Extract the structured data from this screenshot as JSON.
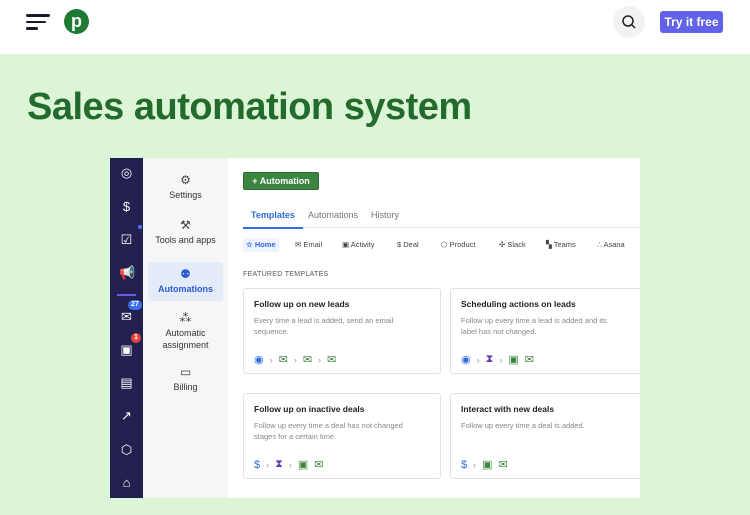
{
  "header": {
    "try_label": "Try it free",
    "logo_letter": "p"
  },
  "title": "Sales automation system",
  "rail": {
    "mail_badge": "27",
    "calendar_badge": "1"
  },
  "subnav": [
    {
      "label": "Settings",
      "icon": "gear-icon"
    },
    {
      "label": "Tools and apps",
      "icon": "tools-icon"
    },
    {
      "label": "Automations",
      "icon": "automation-icon"
    },
    {
      "label": "Automatic assignment",
      "icon": "assignment-icon"
    },
    {
      "label": "Billing",
      "icon": "card-icon"
    }
  ],
  "main": {
    "add_label": "+  Automation",
    "tabs": [
      "Templates",
      "Automations",
      "History"
    ],
    "categories": [
      "Home",
      "Email",
      "Activity",
      "Deal",
      "Product",
      "Slack",
      "Teams",
      "Asana"
    ],
    "featured_label": "FEATURED TEMPLATES",
    "cards": [
      {
        "title": "Follow up on new leads",
        "desc": "Every time a lead is added, send an email sequence."
      },
      {
        "title": "Scheduling actions on leads",
        "desc": "Follow up every time a lead is added and its label has not changed."
      },
      {
        "title": "Follow up on inactive deals",
        "desc": "Follow up every time a deal has not changed stages for a certain time."
      },
      {
        "title": "Interact with new deals",
        "desc": "Follow up every time a deal is added."
      }
    ]
  },
  "colors": {
    "accent": "#6262e8",
    "brand": "#236b2c",
    "background": "#dcf5d6",
    "rail": "#22204f"
  }
}
